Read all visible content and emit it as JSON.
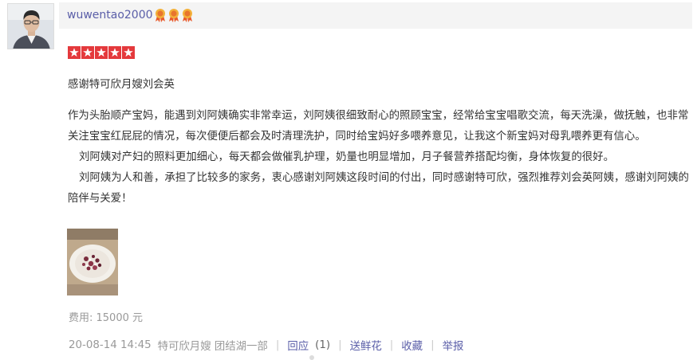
{
  "user": {
    "username": "wuwentao2000",
    "medals": [
      "medal-icon",
      "medal-icon",
      "medal-icon"
    ]
  },
  "review": {
    "rating": 5,
    "title": "感谢特可欣月嫂刘会英",
    "paragraphs": [
      "作为头胎顺产宝妈，能遇到刘阿姨确实非常幸运，刘阿姨很细致耐心的照顾宝宝，经常给宝宝唱歌交流，每天洗澡，做抚触，也非常关注宝宝红屁屁的情况，每次便便后都会及时清理洗护，同时给宝妈好多喂养意见，让我这个新宝妈对母乳喂养更有信心。",
      "刘阿姨对产妇的照料更加细心，每天都会做催乳护理，奶量也明显增加，月子餐营养搭配均衡，身体恢复的很好。",
      "刘阿姨为人和善，承担了比较多的家务，衷心感谢刘阿姨这段时间的付出，同时感谢特可欣，强烈推荐刘会英阿姨，感谢刘阿姨的陪伴与关爱！"
    ],
    "fee": "费用: 15000 元"
  },
  "meta": {
    "timestamp": "20-08-14 14:45",
    "shop": "特可欣月嫂 团结湖一部",
    "reply_label": "回应",
    "reply_count": "(1)",
    "flower_label": "送鲜花",
    "favorite_label": "收藏",
    "report_label": "举报"
  },
  "colors": {
    "star": "#e4393c",
    "link": "#5a5ea8",
    "muted": "#999999",
    "header_bg": "#f4f4f4"
  }
}
